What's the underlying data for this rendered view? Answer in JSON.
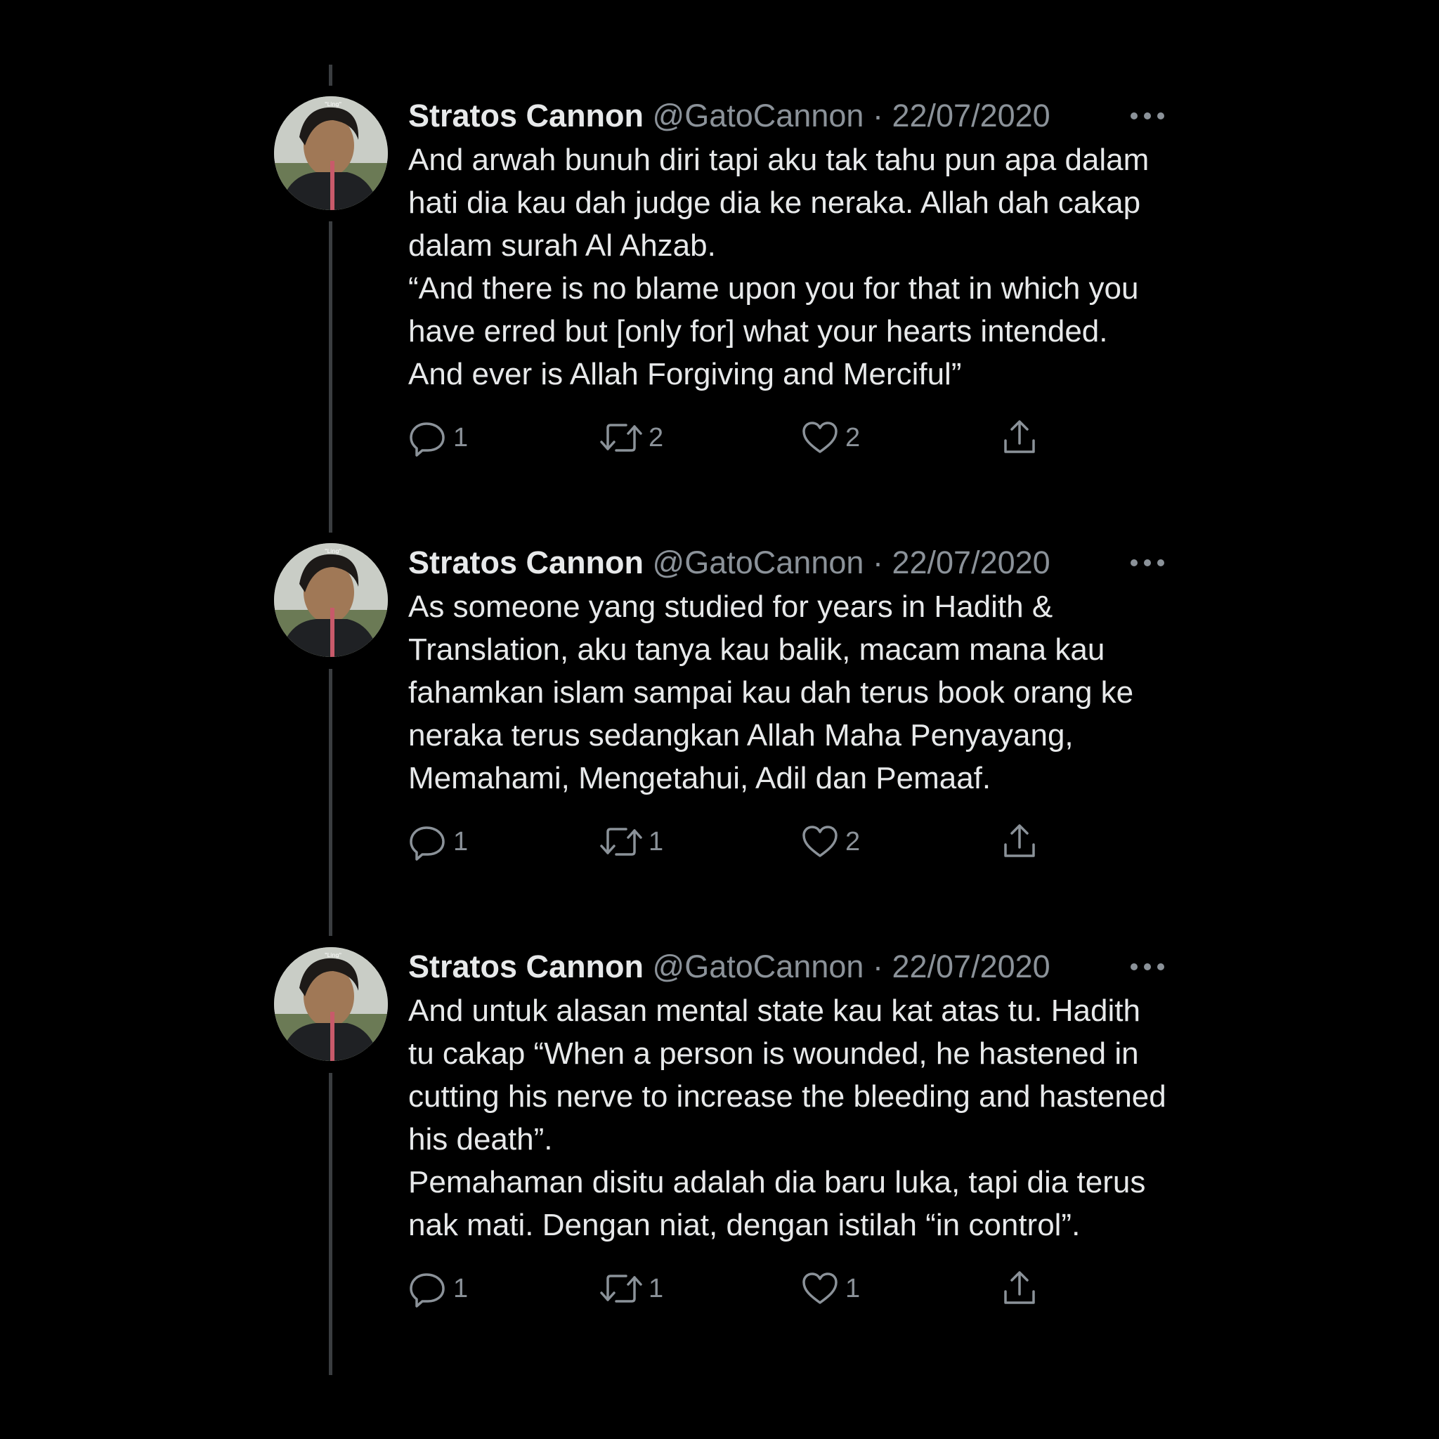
{
  "theme": {
    "background": "#000000",
    "text_primary": "#e7e9ea",
    "text_secondary": "#8b9299",
    "thread_line": "#3a3d40"
  },
  "icons": {
    "reply": "speech-bubble-icon",
    "retweet": "retweet-arrows-icon",
    "like": "heart-icon",
    "share": "share-upload-icon",
    "more": "three-dots-icon"
  },
  "tweets": [
    {
      "name": "Stratos Cannon",
      "handle": "@GatoCannon",
      "separator": "·",
      "date": "22/07/2020",
      "text": "And arwah bunuh diri tapi aku tak tahu pun apa dalam hati dia kau dah judge dia ke neraka. Allah dah cakap dalam surah Al Ahzab.\n“And there is no blame upon you for that in which you have erred but [only for] what your hearts intended. And ever is Allah Forgiving and Merciful”",
      "replies": "1",
      "retweets": "2",
      "likes": "2"
    },
    {
      "name": "Stratos Cannon",
      "handle": "@GatoCannon",
      "separator": "·",
      "date": "22/07/2020",
      "text": "As someone yang studied for years in Hadith & Translation, aku tanya kau balik, macam mana kau fahamkan islam sampai kau dah terus book orang ke neraka terus sedangkan Allah Maha Penyayang, Memahami, Mengetahui, Adil dan Pemaaf.",
      "replies": "1",
      "retweets": "1",
      "likes": "2"
    },
    {
      "name": "Stratos Cannon",
      "handle": "@GatoCannon",
      "separator": "·",
      "date": "22/07/2020",
      "text": "And untuk alasan mental state kau kat atas tu. Hadith tu cakap “When a person is wounded, he hastened in cutting his nerve to increase the bleeding and hastened his death”.\nPemahaman disitu adalah dia baru luka, tapi dia terus nak mati. Dengan niat, dengan istilah “in control”.",
      "replies": "1",
      "retweets": "1",
      "likes": "1"
    }
  ]
}
